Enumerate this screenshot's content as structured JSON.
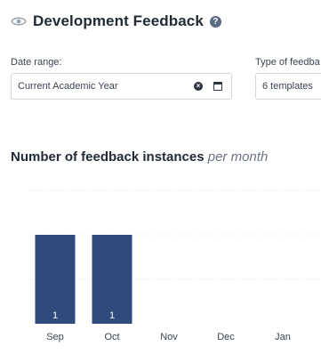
{
  "header": {
    "title": "Development Feedback",
    "help_icon": "?",
    "eye_icon": "eye-icon"
  },
  "filters": {
    "date_range": {
      "label": "Date range:",
      "value": "Current Academic Year"
    },
    "feedback_type": {
      "label": "Type of feedba",
      "value": "6 templates"
    }
  },
  "chart": {
    "title": "Number of feedback instances",
    "subtitle": "per month"
  },
  "chart_data": {
    "type": "bar",
    "categories": [
      "Sep",
      "Oct",
      "Nov",
      "Dec",
      "Jan"
    ],
    "values": [
      1,
      1,
      0,
      0,
      0
    ],
    "data_labels": [
      "1",
      "1",
      "",
      "",
      ""
    ],
    "ylim": [
      0,
      1.5
    ],
    "grid": true,
    "bar_color": "#2e4b7c"
  }
}
